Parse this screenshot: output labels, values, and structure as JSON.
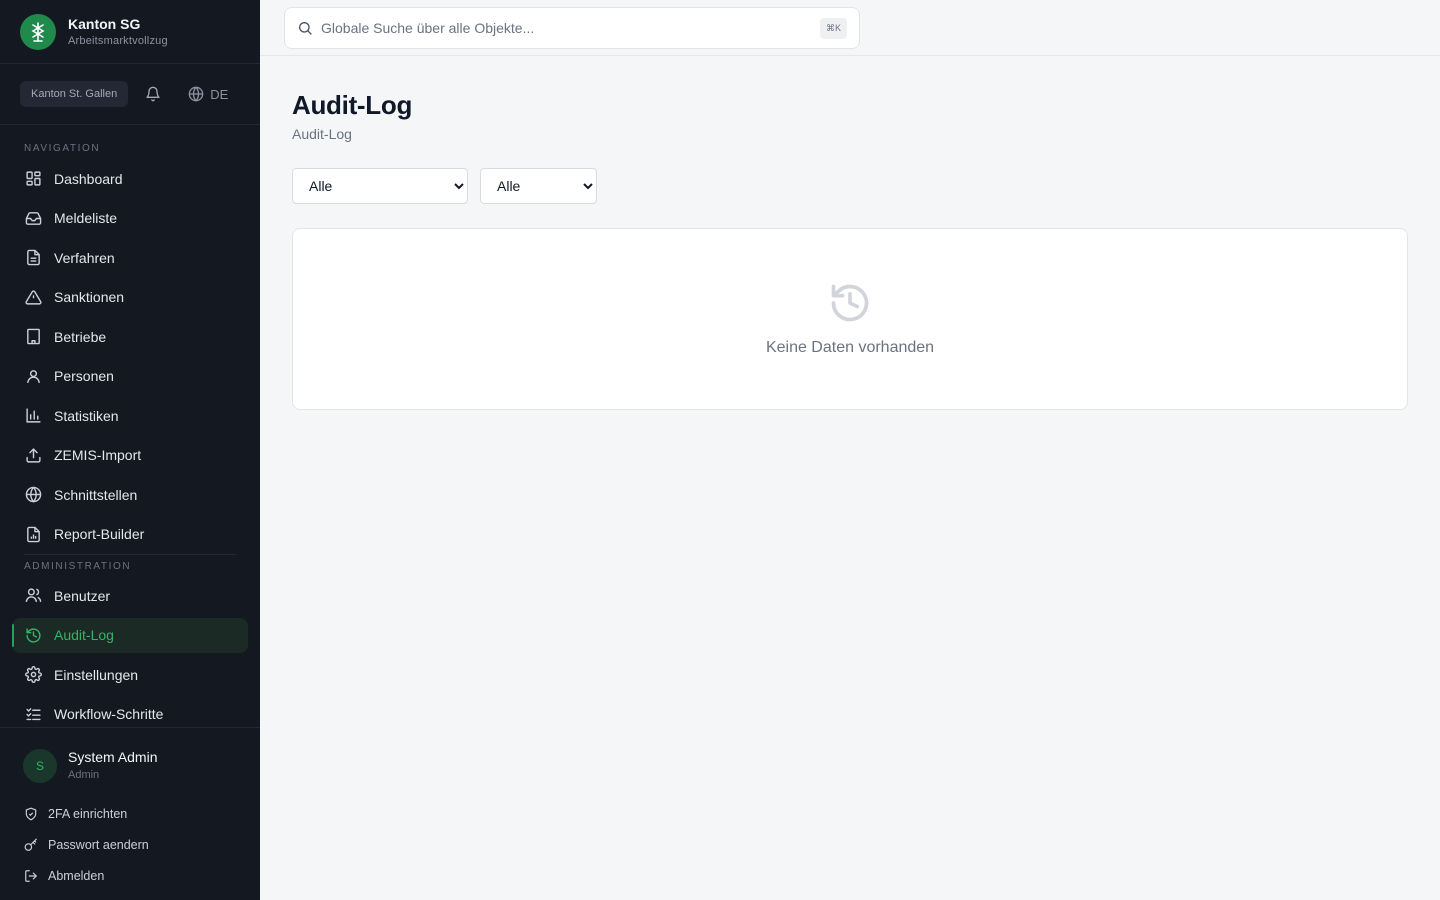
{
  "brand": {
    "title": "Kanton SG",
    "subtitle": "Arbeitsmarktvollzug"
  },
  "toolbar": {
    "canton": "Kanton St. Gallen",
    "language": "DE"
  },
  "nav": {
    "section_label": "NAVIGATION",
    "items": [
      {
        "label": "Dashboard",
        "icon": "grid-icon"
      },
      {
        "label": "Meldeliste",
        "icon": "inbox-icon"
      },
      {
        "label": "Verfahren",
        "icon": "document-icon"
      },
      {
        "label": "Sanktionen",
        "icon": "warning-icon"
      },
      {
        "label": "Betriebe",
        "icon": "building-icon"
      },
      {
        "label": "Personen",
        "icon": "user-icon"
      },
      {
        "label": "Statistiken",
        "icon": "bar-chart-icon"
      },
      {
        "label": "ZEMIS-Import",
        "icon": "upload-icon"
      },
      {
        "label": "Schnittstellen",
        "icon": "globe-icon"
      },
      {
        "label": "Report-Builder",
        "icon": "report-icon"
      }
    ]
  },
  "admin": {
    "section_label": "ADMINISTRATION",
    "items": [
      {
        "label": "Benutzer",
        "icon": "users-icon"
      },
      {
        "label": "Audit-Log",
        "icon": "history-icon",
        "active": true
      },
      {
        "label": "Einstellungen",
        "icon": "gear-icon"
      },
      {
        "label": "Workflow-Schritte",
        "icon": "checklist-icon"
      }
    ]
  },
  "user": {
    "initial": "S",
    "name": "System Admin",
    "role": "Admin",
    "actions": [
      "2FA einrichten",
      "Passwort aendern",
      "Abmelden"
    ]
  },
  "search": {
    "placeholder": "Globale Suche über alle Objekte...",
    "shortcut": "⌘K"
  },
  "page": {
    "title": "Audit-Log",
    "subtitle": "Audit-Log"
  },
  "filters": {
    "filter1": "Alle",
    "filter2": "Alle"
  },
  "empty_state": {
    "text": "Keine Daten vorhanden"
  },
  "colors": {
    "sidebar_bg": "#141821",
    "accent": "#22a35a",
    "page_bg": "#f5f6f8"
  }
}
